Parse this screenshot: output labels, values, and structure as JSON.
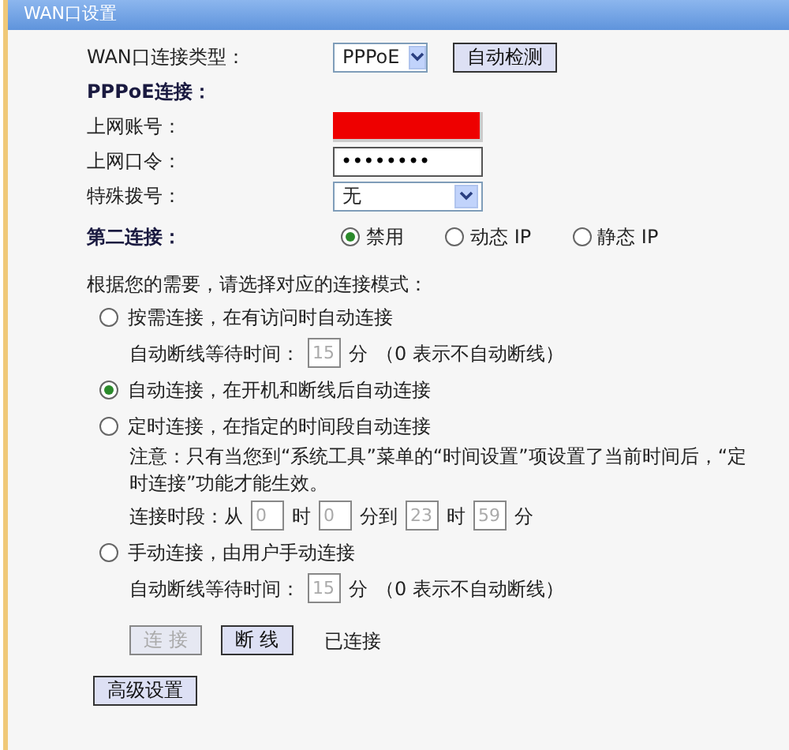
{
  "window": {
    "title": "WAN口设置"
  },
  "wan_type": {
    "label": "WAN口连接类型：",
    "value": "PPPoE",
    "button": "自动检测"
  },
  "pppoe_heading": "PPPoE连接：",
  "account": {
    "label": "上网账号：",
    "redacted": true
  },
  "password": {
    "label": "上网口令：",
    "value": "••••••••"
  },
  "special_dial": {
    "label": "特殊拨号：",
    "value": "无"
  },
  "second_connection": {
    "label": "第二连接：",
    "options": [
      {
        "label": "禁用",
        "selected": true
      },
      {
        "label": "动态 IP",
        "selected": false
      },
      {
        "label": "静态 IP",
        "selected": false
      }
    ]
  },
  "mode_prompt": "根据您的需要，请选择对应的连接模式：",
  "modes": [
    {
      "label": "按需连接，在有访问时自动连接",
      "selected": false,
      "details": [
        {
          "kind": "wait",
          "label": "自动断线等待时间：",
          "value": "15",
          "disabled": true,
          "unit": "分",
          "note": "（0 表示不自动断线）"
        }
      ]
    },
    {
      "label": "自动连接，在开机和断线后自动连接",
      "selected": true
    },
    {
      "label": "定时连接，在指定的时间段自动连接",
      "selected": false,
      "details": [
        {
          "kind": "note",
          "text": "注意：只有当您到“系统工具”菜单的“时间设置”项设置了当前时间后，“定时连接”功能才能生效。"
        },
        {
          "kind": "period",
          "label": "连接时段：从",
          "disabled": true,
          "parts": [
            {
              "value": "0",
              "unit": "时"
            },
            {
              "value": "0",
              "unit": "分到"
            },
            {
              "value": "23",
              "unit": "时"
            },
            {
              "value": "59",
              "unit": "分"
            }
          ]
        }
      ]
    },
    {
      "label": "手动连接，由用户手动连接",
      "selected": false,
      "details": [
        {
          "kind": "wait",
          "label": "自动断线等待时间：",
          "value": "15",
          "disabled": true,
          "unit": "分",
          "note": "（0 表示不自动断线）"
        }
      ]
    }
  ],
  "actions": [
    {
      "label": "连 接",
      "disabled": true
    },
    {
      "label": "断 线",
      "disabled": false
    }
  ],
  "status": "已连接",
  "advanced_button": "高级设置"
}
